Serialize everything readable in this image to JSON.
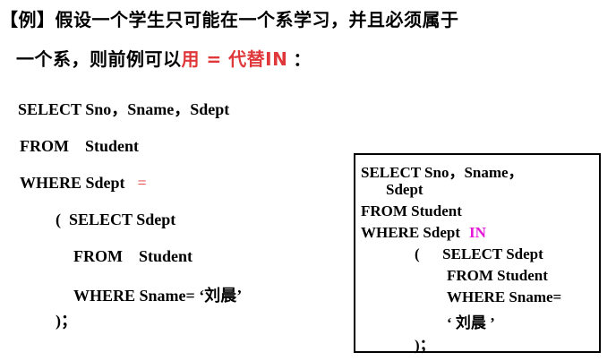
{
  "heading": {
    "line1": "【例】假设一个学生只可能在一个系学习，并且必须属于",
    "line2_prefix": "一个系，则前例可以",
    "line2_highlight": "用 = 代替IN",
    "line2_suffix": "："
  },
  "left_query": {
    "l1": "SELECT Sno，Sname，Sdept",
    "l2": "FROM    Student",
    "l3_text": "WHERE Sdept",
    "l3_op": "=",
    "l4": "(  SELECT Sdept",
    "l5": "FROM    Student",
    "l6": "WHERE Sname= ‘刘晨’",
    "l7": ")；"
  },
  "right_query": {
    "l1": "SELECT Sno，Sname，",
    "l2": "Sdept",
    "l3": "FROM Student",
    "l4_text": "WHERE Sdept",
    "l4_op": "IN",
    "l5": "(      SELECT Sdept",
    "l6": "FROM Student",
    "l7": "WHERE Sname=",
    "l8": "‘ 刘晨 ’",
    "l9": ")；"
  },
  "colors": {
    "highlight_red": "#e0383a",
    "in_magenta": "#e51ad9",
    "text": "#000000",
    "background": "#ffffff"
  }
}
